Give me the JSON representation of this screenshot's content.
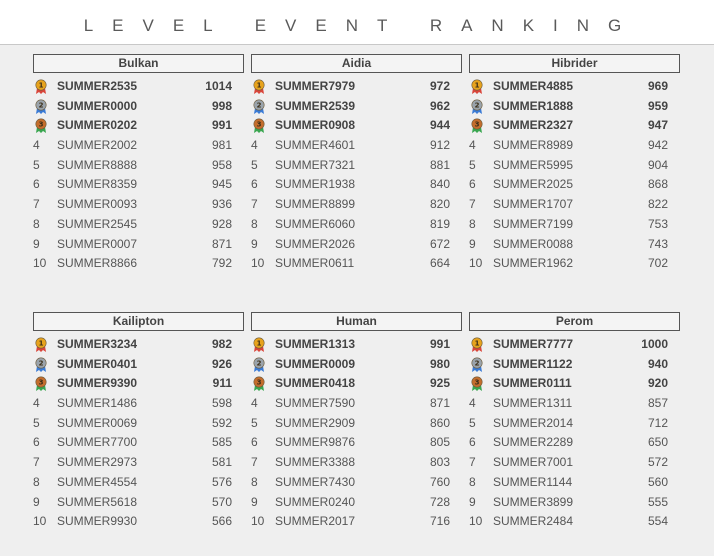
{
  "header": {
    "title": "LEVEL EVENT RANKING"
  },
  "colors": {
    "gold": "#e7a31d",
    "silver": "#9aa3ab",
    "bronze": "#c46d2c",
    "ribbon_red": "#d9453a",
    "ribbon_blue": "#3a7bd5",
    "ribbon_green": "#3aa650"
  },
  "panels": [
    {
      "name": "Bulkan",
      "rows": [
        {
          "rank": "1",
          "medal": "gold",
          "name": "SUMMER2535",
          "score": "1014"
        },
        {
          "rank": "2",
          "medal": "silver",
          "name": "SUMMER0000",
          "score": "998"
        },
        {
          "rank": "3",
          "medal": "bronze",
          "name": "SUMMER0202",
          "score": "991"
        },
        {
          "rank": "4",
          "name": "SUMMER2002",
          "score": "981"
        },
        {
          "rank": "5",
          "name": "SUMMER8888",
          "score": "958"
        },
        {
          "rank": "6",
          "name": "SUMMER8359",
          "score": "945"
        },
        {
          "rank": "7",
          "name": "SUMMER0093",
          "score": "936"
        },
        {
          "rank": "8",
          "name": "SUMMER2545",
          "score": "928"
        },
        {
          "rank": "9",
          "name": "SUMMER0007",
          "score": "871"
        },
        {
          "rank": "10",
          "name": "SUMMER8866",
          "score": "792"
        }
      ]
    },
    {
      "name": "Aidia",
      "rows": [
        {
          "rank": "1",
          "medal": "gold",
          "name": "SUMMER7979",
          "score": "972"
        },
        {
          "rank": "2",
          "medal": "silver",
          "name": "SUMMER2539",
          "score": "962"
        },
        {
          "rank": "3",
          "medal": "bronze",
          "name": "SUMMER0908",
          "score": "944"
        },
        {
          "rank": "4",
          "name": "SUMMER4601",
          "score": "912"
        },
        {
          "rank": "5",
          "name": "SUMMER7321",
          "score": "881"
        },
        {
          "rank": "6",
          "name": "SUMMER1938",
          "score": "840"
        },
        {
          "rank": "7",
          "name": "SUMMER8899",
          "score": "820"
        },
        {
          "rank": "8",
          "name": "SUMMER6060",
          "score": "819"
        },
        {
          "rank": "9",
          "name": "SUMMER2026",
          "score": "672"
        },
        {
          "rank": "10",
          "name": "SUMMER0611",
          "score": "664"
        }
      ]
    },
    {
      "name": "Hibrider",
      "rows": [
        {
          "rank": "1",
          "medal": "gold",
          "name": "SUMMER4885",
          "score": "969"
        },
        {
          "rank": "2",
          "medal": "silver",
          "name": "SUMMER1888",
          "score": "959"
        },
        {
          "rank": "3",
          "medal": "bronze",
          "name": "SUMMER2327",
          "score": "947"
        },
        {
          "rank": "4",
          "name": "SUMMER8989",
          "score": "942"
        },
        {
          "rank": "5",
          "name": "SUMMER5995",
          "score": "904"
        },
        {
          "rank": "6",
          "name": "SUMMER2025",
          "score": "868"
        },
        {
          "rank": "7",
          "name": "SUMMER1707",
          "score": "822"
        },
        {
          "rank": "8",
          "name": "SUMMER7199",
          "score": "753"
        },
        {
          "rank": "9",
          "name": "SUMMER0088",
          "score": "743"
        },
        {
          "rank": "10",
          "name": "SUMMER1962",
          "score": "702"
        }
      ]
    },
    {
      "name": "Kailipton",
      "rows": [
        {
          "rank": "1",
          "medal": "gold",
          "name": "SUMMER3234",
          "score": "982"
        },
        {
          "rank": "2",
          "medal": "silver",
          "name": "SUMMER0401",
          "score": "926"
        },
        {
          "rank": "3",
          "medal": "bronze",
          "name": "SUMMER9390",
          "score": "911"
        },
        {
          "rank": "4",
          "name": "SUMMER1486",
          "score": "598"
        },
        {
          "rank": "5",
          "name": "SUMMER0069",
          "score": "592"
        },
        {
          "rank": "6",
          "name": "SUMMER7700",
          "score": "585"
        },
        {
          "rank": "7",
          "name": "SUMMER2973",
          "score": "581"
        },
        {
          "rank": "8",
          "name": "SUMMER4554",
          "score": "576"
        },
        {
          "rank": "9",
          "name": "SUMMER5618",
          "score": "570"
        },
        {
          "rank": "10",
          "name": "SUMMER9930",
          "score": "566"
        }
      ]
    },
    {
      "name": "Human",
      "rows": [
        {
          "rank": "1",
          "medal": "gold",
          "name": "SUMMER1313",
          "score": "991"
        },
        {
          "rank": "2",
          "medal": "silver",
          "name": "SUMMER0009",
          "score": "980"
        },
        {
          "rank": "3",
          "medal": "bronze",
          "name": "SUMMER0418",
          "score": "925"
        },
        {
          "rank": "4",
          "name": "SUMMER7590",
          "score": "871"
        },
        {
          "rank": "5",
          "name": "SUMMER2909",
          "score": "860"
        },
        {
          "rank": "6",
          "name": "SUMMER9876",
          "score": "805"
        },
        {
          "rank": "7",
          "name": "SUMMER3388",
          "score": "803"
        },
        {
          "rank": "8",
          "name": "SUMMER7430",
          "score": "760"
        },
        {
          "rank": "9",
          "name": "SUMMER0240",
          "score": "728"
        },
        {
          "rank": "10",
          "name": "SUMMER2017",
          "score": "716"
        }
      ]
    },
    {
      "name": "Perom",
      "rows": [
        {
          "rank": "1",
          "medal": "gold",
          "name": "SUMMER7777",
          "score": "1000"
        },
        {
          "rank": "2",
          "medal": "silver",
          "name": "SUMMER1122",
          "score": "940"
        },
        {
          "rank": "3",
          "medal": "bronze",
          "name": "SUMMER0111",
          "score": "920"
        },
        {
          "rank": "4",
          "name": "SUMMER1311",
          "score": "857"
        },
        {
          "rank": "5",
          "name": "SUMMER2014",
          "score": "712"
        },
        {
          "rank": "6",
          "name": "SUMMER2289",
          "score": "650"
        },
        {
          "rank": "7",
          "name": "SUMMER7001",
          "score": "572"
        },
        {
          "rank": "8",
          "name": "SUMMER1144",
          "score": "560"
        },
        {
          "rank": "9",
          "name": "SUMMER3899",
          "score": "555"
        },
        {
          "rank": "10",
          "name": "SUMMER2484",
          "score": "554"
        }
      ]
    }
  ]
}
